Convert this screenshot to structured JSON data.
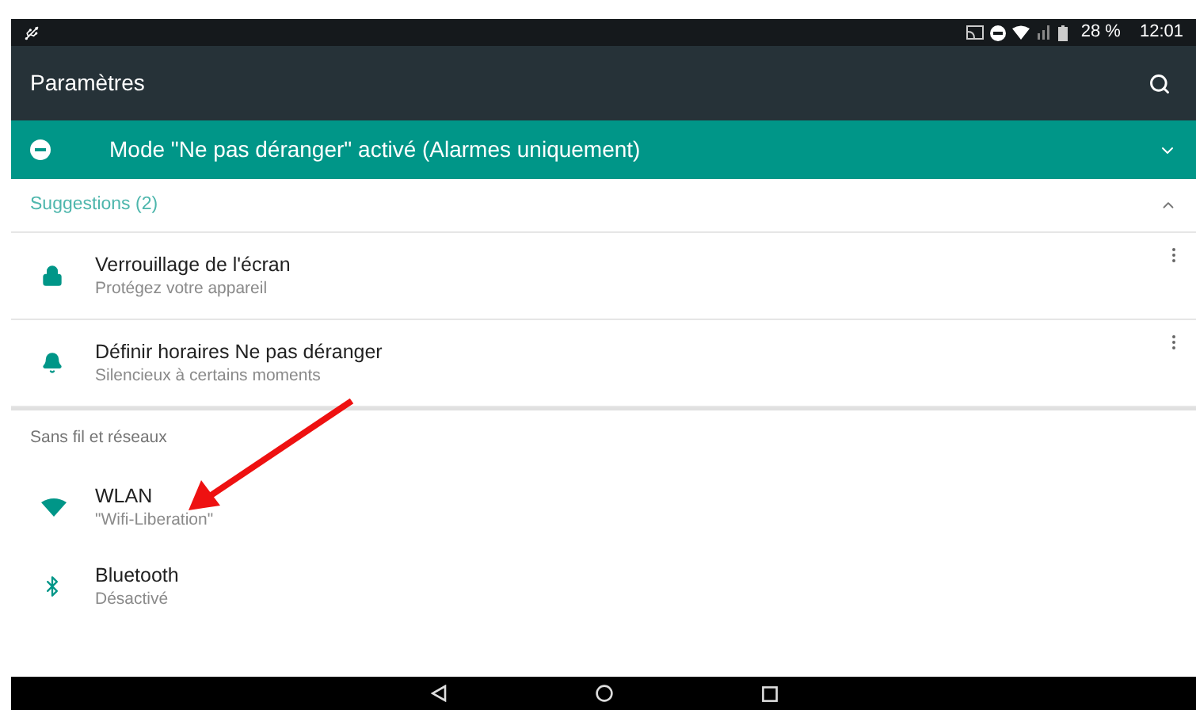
{
  "status_bar": {
    "battery": "28 %",
    "time": "12:01"
  },
  "toolbar": {
    "title": "Paramètres"
  },
  "dnd_banner": {
    "text": "Mode \"Ne pas déranger\" activé (Alarmes uniquement)",
    "expanded": false
  },
  "sections": [
    {
      "title": "Suggestions (2)",
      "kind": "suggestions",
      "expanded": true,
      "items": [
        {
          "kind": "lock",
          "title": "Verrouillage de l'écran",
          "subtitle": "Protégez votre appareil"
        },
        {
          "kind": "bell",
          "title": "Définir horaires Ne pas déranger",
          "subtitle": "Silencieux à certains moments"
        }
      ]
    },
    {
      "title": "Sans fil et réseaux",
      "kind": "category",
      "items": [
        {
          "kind": "wifi",
          "title": "WLAN",
          "subtitle": "\"Wifi-Liberation\""
        },
        {
          "kind": "bluetooth",
          "title": "Bluetooth",
          "subtitle": "Désactivé"
        }
      ]
    }
  ]
}
